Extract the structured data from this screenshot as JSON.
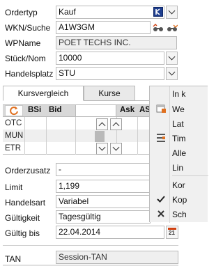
{
  "form": {
    "ordertyp": {
      "label": "Ordertyp",
      "value": "Kauf"
    },
    "wkn": {
      "label": "WKN/Suche",
      "value": "A1W3GM"
    },
    "wpname": {
      "label": "WPName",
      "value": "POET TECHS INC."
    },
    "stueck": {
      "label": "Stück/Nom",
      "value": "10000"
    },
    "handelsplatz": {
      "label": "Handelsplatz",
      "value": "STU"
    }
  },
  "tabs": [
    {
      "label": "Kursvergleich"
    },
    {
      "label": "Kurse"
    }
  ],
  "grid": {
    "headers": {
      "bsi": "BSi",
      "bid": "Bid",
      "ask": "Ask",
      "as": "AS"
    },
    "rows": [
      "OTC",
      "MUN",
      "ETR"
    ]
  },
  "order": {
    "orderzusatz": {
      "label": "Orderzusatz",
      "value": "-"
    },
    "limit": {
      "label": "Limit",
      "value": "1,199"
    },
    "handelsart": {
      "label": "Handelsart",
      "value": "Variabel"
    },
    "gueltigkeit": {
      "label": "Gültigkeit",
      "value": "Tagesgültig"
    },
    "gueltig_bis": {
      "label": "Gültig bis",
      "value": "22.04.2014"
    },
    "tan": {
      "label": "TAN",
      "value": "Session-TAN"
    }
  },
  "menu": {
    "items": [
      "In k",
      "We",
      "Lat",
      "Tim",
      "Alle",
      "Lin",
      "Kor",
      "Kop",
      "Sch"
    ]
  },
  "icons": {
    "calendar_day": "21"
  },
  "colors": {
    "accent_blue": "#1f3f8f",
    "refresh_orange": "#e07020"
  }
}
